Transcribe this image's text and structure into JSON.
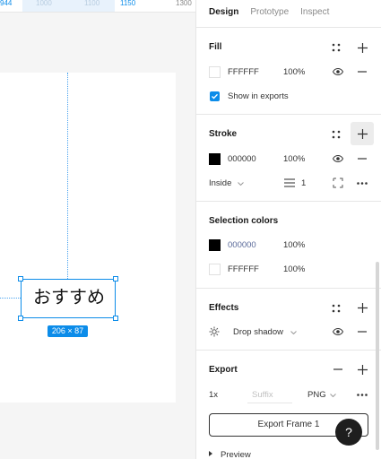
{
  "ruler": {
    "marks": [
      "944",
      "1000",
      "1100",
      "1150",
      "1300"
    ]
  },
  "canvas": {
    "text_content": "おすすめ",
    "size_badge": "206 × 87"
  },
  "panel": {
    "tabs": [
      "Design",
      "Prototype",
      "Inspect"
    ],
    "fill": {
      "title": "Fill",
      "hex": "FFFFFF",
      "opacity": "100%",
      "color": "#ffffff",
      "show_in_exports": "Show in exports"
    },
    "stroke": {
      "title": "Stroke",
      "hex": "000000",
      "opacity": "100%",
      "color": "#000000",
      "position": "Inside",
      "weight": "1"
    },
    "selection_colors": {
      "title": "Selection colors",
      "items": [
        {
          "hex": "000000",
          "opacity": "100%",
          "color": "#000000"
        },
        {
          "hex": "FFFFFF",
          "opacity": "100%",
          "color": "#ffffff"
        }
      ]
    },
    "effects": {
      "title": "Effects",
      "effect": "Drop shadow"
    },
    "export": {
      "title": "Export",
      "scale": "1x",
      "suffix_placeholder": "Suffix",
      "format": "PNG",
      "button_label": "Export Frame 1",
      "preview_label": "Preview"
    },
    "help_label": "?"
  },
  "colors": {
    "accent": "#0c8ce9"
  }
}
